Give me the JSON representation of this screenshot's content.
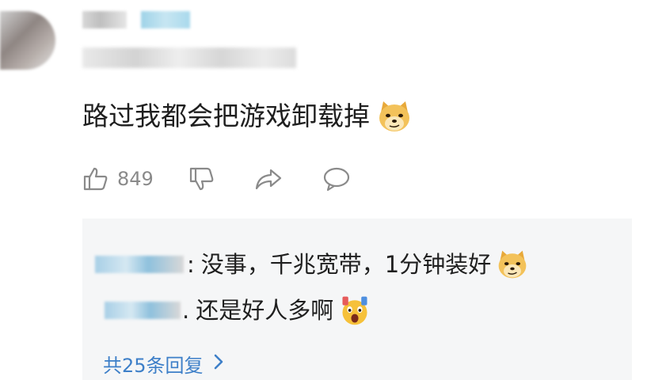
{
  "comment": {
    "text": "路过我都会把游戏卸载掉",
    "emoji": "doge-emoji-icon",
    "like_count": "849"
  },
  "actions": {
    "like_icon": "thumbs-up-icon",
    "dislike_icon": "thumbs-down-icon",
    "share_icon": "share-icon",
    "reply_icon": "comment-bubble-icon"
  },
  "replies": [
    {
      "separator": ":",
      "text": "没事，千兆宽带，1分钟装好",
      "emoji": "doge-emoji-icon"
    },
    {
      "separator": ".",
      "text": "还是好人多啊",
      "emoji": "shocked-emoji-icon"
    }
  ],
  "more_replies": {
    "label": "共25条回复"
  },
  "colors": {
    "link": "#3d7fc8",
    "reply_bg": "#f5f6f7",
    "icon_gray": "#8a8a8a"
  }
}
